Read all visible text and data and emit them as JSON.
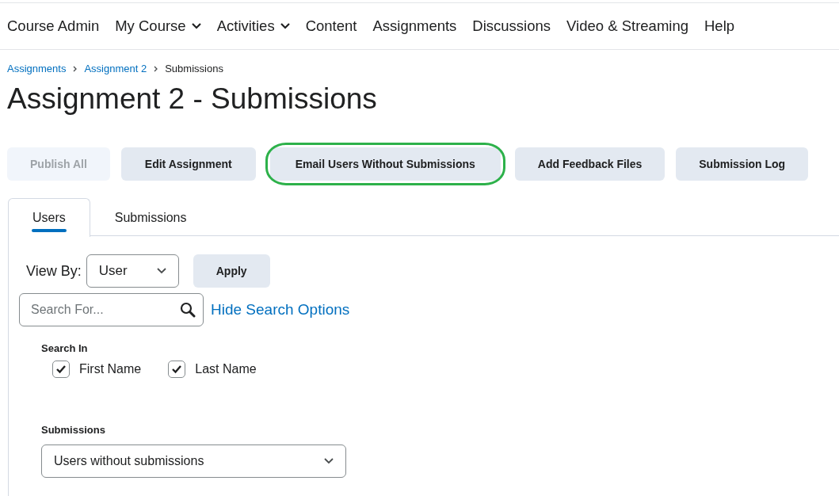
{
  "nav": [
    {
      "label": "Course Admin",
      "dropdown": false
    },
    {
      "label": "My Course",
      "dropdown": true
    },
    {
      "label": "Activities",
      "dropdown": true
    },
    {
      "label": "Content",
      "dropdown": false
    },
    {
      "label": "Assignments",
      "dropdown": false
    },
    {
      "label": "Discussions",
      "dropdown": false
    },
    {
      "label": "Video & Streaming",
      "dropdown": false
    },
    {
      "label": "Help",
      "dropdown": false
    }
  ],
  "breadcrumb": [
    {
      "label": "Assignments",
      "link": true
    },
    {
      "label": "Assignment 2",
      "link": true
    },
    {
      "label": "Submissions",
      "link": false
    }
  ],
  "page_title": "Assignment 2 - Submissions",
  "buttons": [
    {
      "label": "Publish All",
      "disabled": true,
      "highlighted": false
    },
    {
      "label": "Edit Assignment",
      "disabled": false,
      "highlighted": false
    },
    {
      "label": "Email Users Without Submissions",
      "disabled": false,
      "highlighted": true
    },
    {
      "label": "Add Feedback Files",
      "disabled": false,
      "highlighted": false
    },
    {
      "label": "Submission Log",
      "disabled": false,
      "highlighted": false
    }
  ],
  "tabs": [
    {
      "label": "Users",
      "selected": true
    },
    {
      "label": "Submissions",
      "selected": false
    }
  ],
  "view_by": {
    "label": "View By:",
    "value": "User",
    "apply": "Apply"
  },
  "search": {
    "placeholder": "Search For...",
    "toggle": "Hide Search Options"
  },
  "search_in": {
    "label": "Search In",
    "options": [
      {
        "label": "First Name",
        "checked": true
      },
      {
        "label": "Last Name",
        "checked": true
      }
    ]
  },
  "submissions_filter": {
    "label": "Submissions",
    "value": "Users without submissions"
  }
}
